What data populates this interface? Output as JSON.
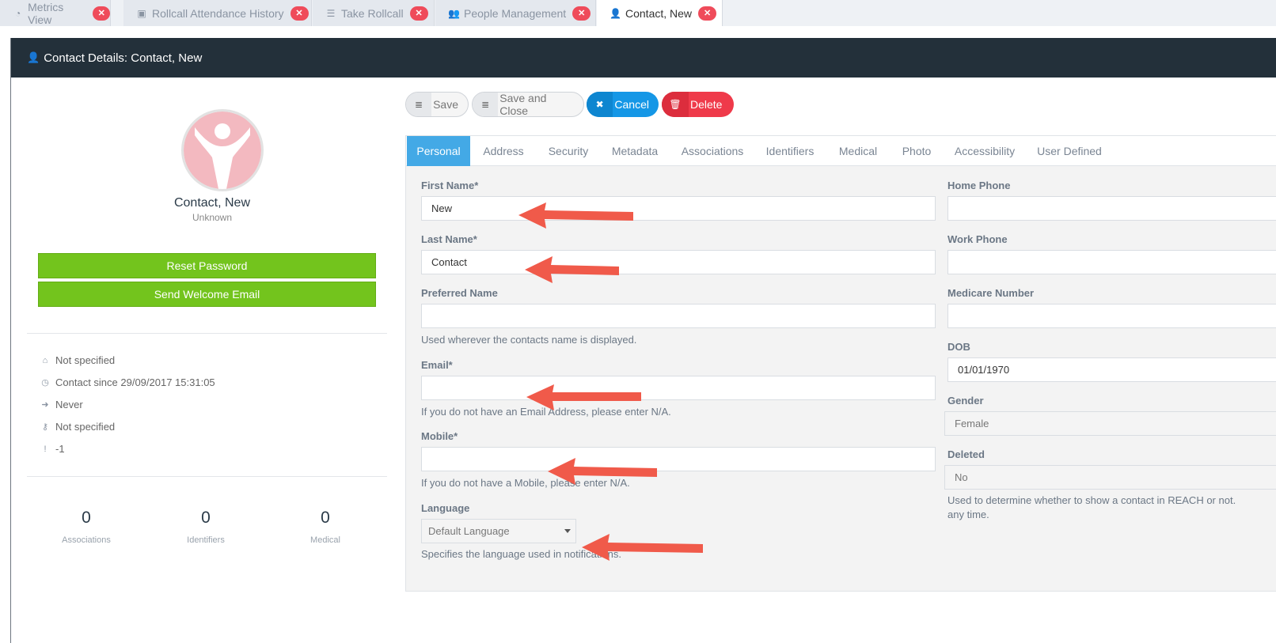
{
  "tabs": [
    {
      "label": "Metrics View",
      "icon": "dashboard-icon",
      "active": false
    },
    {
      "label": "Rollcall Attendance History",
      "icon": "briefcase-icon",
      "active": false
    },
    {
      "label": "Take Rollcall",
      "icon": "list-icon",
      "active": false
    },
    {
      "label": "People Management",
      "icon": "users-icon",
      "active": false
    },
    {
      "label": "Contact, New",
      "icon": "user-icon",
      "active": true
    }
  ],
  "panel": {
    "title": "Contact Details: Contact, New",
    "icon": "user-icon"
  },
  "profile": {
    "name": "Contact, New",
    "subtitle": "Unknown",
    "reset_password": "Reset Password",
    "send_welcome": "Send Welcome Email",
    "info": [
      {
        "icon": "home-icon",
        "text": "Not specified"
      },
      {
        "icon": "clock-icon",
        "text": "Contact since 29/09/2017 15:31:05"
      },
      {
        "icon": "sign-in-icon",
        "text": "Never"
      },
      {
        "icon": "key-icon",
        "text": "Not specified"
      },
      {
        "icon": "exclamation-icon",
        "text": "-1"
      }
    ],
    "stats": [
      {
        "value": "0",
        "label": "Associations"
      },
      {
        "value": "0",
        "label": "Identifiers"
      },
      {
        "value": "0",
        "label": "Medical"
      }
    ]
  },
  "toolbar": {
    "save": "Save",
    "save_close": "Save and Close",
    "cancel": "Cancel",
    "delete": "Delete"
  },
  "form_tabs": [
    "Personal",
    "Address",
    "Security",
    "Metadata",
    "Associations",
    "Identifiers",
    "Medical",
    "Photo",
    "Accessibility",
    "User Defined"
  ],
  "form": {
    "first_name": {
      "label": "First Name*",
      "value": "New"
    },
    "last_name": {
      "label": "Last Name*",
      "value": "Contact"
    },
    "preferred_name": {
      "label": "Preferred Name",
      "value": "",
      "help": "Used wherever the contacts name is displayed."
    },
    "email": {
      "label": "Email*",
      "value": "",
      "help": "If you do not have an Email Address, please enter N/A."
    },
    "mobile": {
      "label": "Mobile*",
      "value": "",
      "help": "If you do not have a Mobile, please enter N/A."
    },
    "language": {
      "label": "Language",
      "value": "Default Language",
      "help": "Specifies the language used in notifications."
    },
    "home_phone": {
      "label": "Home Phone",
      "value": ""
    },
    "work_phone": {
      "label": "Work Phone",
      "value": ""
    },
    "medicare": {
      "label": "Medicare Number",
      "value": ""
    },
    "dob": {
      "label": "DOB",
      "value": "01/01/1970"
    },
    "gender": {
      "label": "Gender",
      "value": "Female"
    },
    "deleted": {
      "label": "Deleted",
      "value": "No",
      "help_line1": "Used to determine whether to show a contact in REACH or not.",
      "help_line2": "any time."
    }
  },
  "colors": {
    "accent": "#43a9e6",
    "green": "#73c41d",
    "red": "#ef3a4a",
    "blue": "#1597e6",
    "header": "#23303a",
    "annotation_arrow": "#f05a4a"
  }
}
